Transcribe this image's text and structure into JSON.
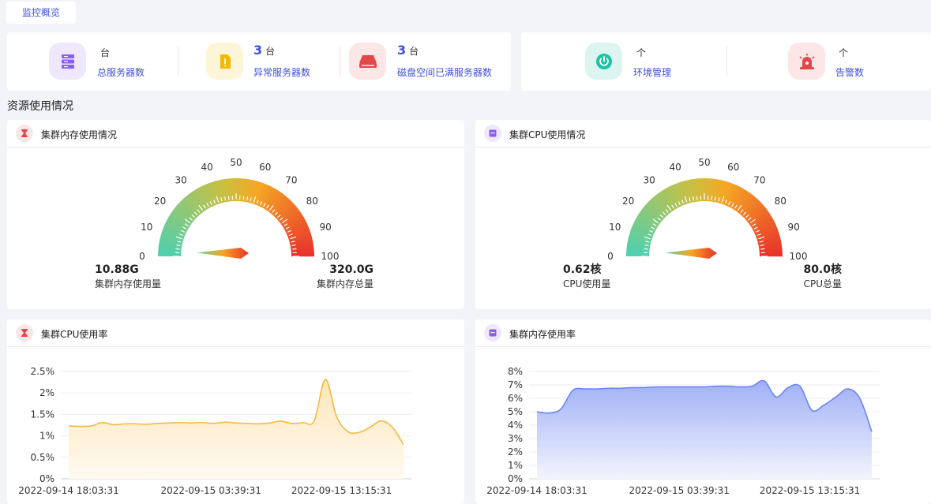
{
  "tab": {
    "label": "监控概览"
  },
  "stats": [
    {
      "value": "",
      "unit": "台",
      "label": "总服务器数",
      "color": "#8b5cf6",
      "bg": "#efe8fd",
      "icon": "server-icon"
    },
    {
      "value": "3",
      "unit": "台",
      "label": "异常服务器数",
      "color": "#f5b800",
      "bg": "#fdf5d8",
      "icon": "warning-file-icon"
    },
    {
      "value": "3",
      "unit": "台",
      "label": "磁盘空间已满服务器数",
      "color": "#e34848",
      "bg": "#fde6e6",
      "icon": "disk-full-icon"
    },
    {
      "value": "",
      "unit": "个",
      "label": "环境管理",
      "color": "#1ec2a4",
      "bg": "#dcf5f0",
      "icon": "power-icon"
    },
    {
      "value": "",
      "unit": "个",
      "label": "告警数",
      "color": "#e34848",
      "bg": "#fde6e6",
      "icon": "alarm-siren-icon"
    }
  ],
  "section_title": "资源使用情况",
  "panels": {
    "memory_gauge": {
      "title": "集群内存使用情况",
      "icon": "hourglass-icon",
      "used_value": "10.88G",
      "used_label": "集群内存使用量",
      "total_value": "320.0G",
      "total_label": "集群内存总量",
      "ticks": [
        "0",
        "10",
        "20",
        "30",
        "40",
        "50",
        "60",
        "70",
        "80",
        "90",
        "100"
      ],
      "percent": 3.4
    },
    "cpu_gauge": {
      "title": "集群CPU使用情况",
      "icon": "cpu-icon",
      "used_value": "0.62核",
      "used_label": "CPU使用量",
      "total_value": "80.0核",
      "total_label": "CPU总量",
      "ticks": [
        "0",
        "10",
        "20",
        "30",
        "40",
        "50",
        "60",
        "70",
        "80",
        "90",
        "100"
      ],
      "percent": 0.8
    },
    "cpu_rate": {
      "title": "集群CPU使用率",
      "icon": "hourglass-icon"
    },
    "mem_rate": {
      "title": "集群内存使用率",
      "icon": "cpu-icon"
    }
  },
  "chart_data": [
    {
      "type": "area",
      "title": "集群CPU使用率",
      "ylabel": "",
      "ylim": [
        0,
        2.5
      ],
      "yticks": [
        "0%",
        "0.5%",
        "1%",
        "1.5%",
        "2%",
        "2.5%"
      ],
      "xticks": [
        "2022-09-14 18:03:31",
        "2022-09-15 03:39:31",
        "2022-09-15 13:15:31"
      ],
      "color": "#f5b942",
      "values": [
        1.23,
        1.22,
        1.23,
        1.31,
        1.26,
        1.28,
        1.28,
        1.27,
        1.29,
        1.3,
        1.31,
        1.3,
        1.31,
        1.29,
        1.32,
        1.3,
        1.29,
        1.28,
        1.3,
        1.34,
        1.29,
        1.31,
        1.35,
        2.32,
        1.45,
        1.1,
        1.08,
        1.2,
        1.35,
        1.2,
        0.8
      ]
    },
    {
      "type": "area",
      "title": "集群内存使用率",
      "ylabel": "",
      "ylim": [
        0,
        8
      ],
      "yticks": [
        "0%",
        "1%",
        "2%",
        "3%",
        "4%",
        "5%",
        "6%",
        "7%",
        "8%"
      ],
      "xticks": [
        "2022-09-14 18:03:31",
        "2022-09-15 03:39:31",
        "2022-09-15 13:15:31"
      ],
      "color": "#6b86ef",
      "values": [
        5.0,
        4.9,
        5.2,
        6.6,
        6.7,
        6.7,
        6.75,
        6.75,
        6.8,
        6.8,
        6.85,
        6.85,
        6.85,
        6.85,
        6.85,
        6.9,
        6.9,
        6.85,
        6.9,
        7.3,
        6.1,
        6.8,
        6.9,
        5.1,
        5.5,
        6.1,
        6.7,
        6.0,
        3.5
      ]
    }
  ]
}
